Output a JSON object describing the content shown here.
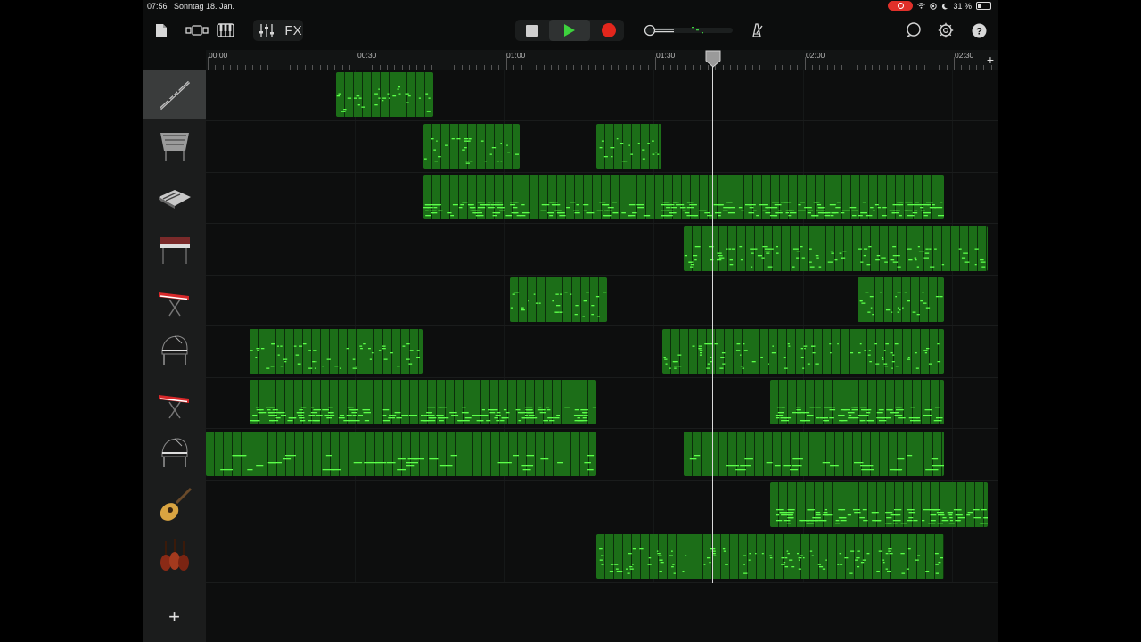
{
  "status": {
    "time": "07:56",
    "date": "Sonntag 18. Jan.",
    "battery": "31 %"
  },
  "toolbar": {
    "fx_label": "FX",
    "accent_play": "#3dd23d",
    "accent_record": "#e3261c"
  },
  "ruler": {
    "labels": [
      "00:00",
      "00:30",
      "01:00",
      "01:30",
      "02:00",
      "02:30"
    ]
  },
  "tracks": [
    {
      "name": "track-flute",
      "icon": "flute-icon",
      "selected": true
    },
    {
      "name": "track-vibraphone",
      "icon": "vibraphone-icon"
    },
    {
      "name": "track-synth",
      "icon": "synth-keyboard-icon"
    },
    {
      "name": "track-electric-piano",
      "icon": "electric-piano-icon"
    },
    {
      "name": "track-red-keyboard-1",
      "icon": "red-keyboard-icon"
    },
    {
      "name": "track-grand-piano-1",
      "icon": "grand-piano-icon"
    },
    {
      "name": "track-red-keyboard-2",
      "icon": "red-keyboard-icon"
    },
    {
      "name": "track-grand-piano-2",
      "icon": "grand-piano-icon"
    },
    {
      "name": "track-acoustic-guitar",
      "icon": "acoustic-guitar-icon"
    },
    {
      "name": "track-strings",
      "icon": "strings-icon"
    }
  ],
  "add_track_label": "+",
  "add_section_label": "+"
}
